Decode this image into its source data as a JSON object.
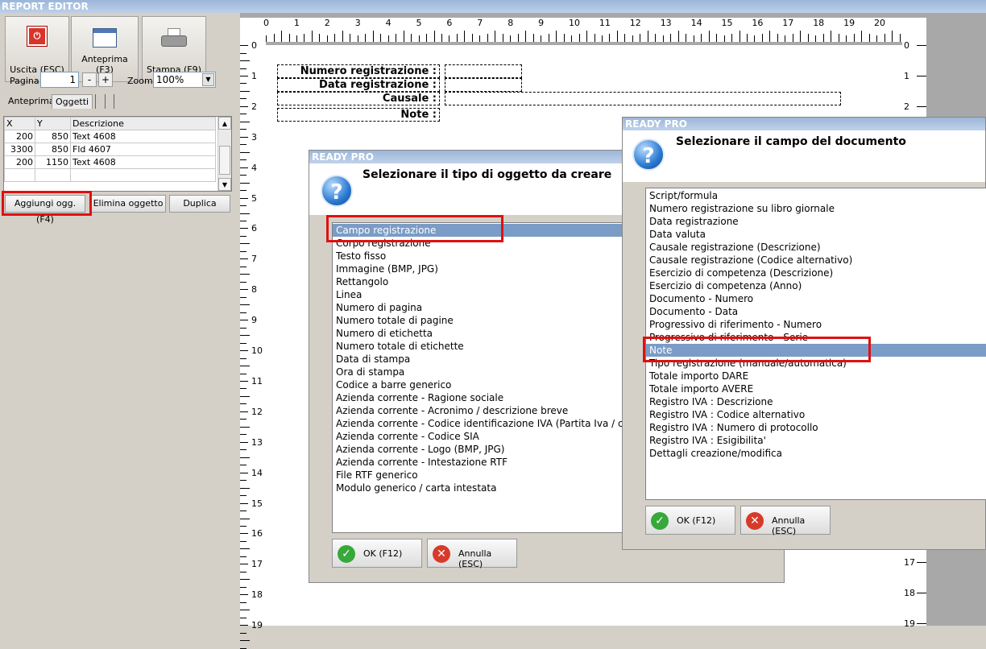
{
  "app": {
    "title": "REPORT EDITOR"
  },
  "toolbar": {
    "exit": "Uscita (ESC)",
    "preview": "Anteprima (F3)",
    "print": "Stampa (F9)"
  },
  "pager": {
    "page_label": "Pagina",
    "page_value": "1",
    "minus": "-",
    "plus": "+",
    "zoom_label": "Zoom",
    "zoom_value": "100%"
  },
  "tabs": {
    "preview": "Anteprima",
    "objects": "Oggetti"
  },
  "grid": {
    "headers": [
      "X",
      "Y",
      "Descrizione"
    ],
    "rows": [
      [
        "200",
        "850",
        "Text 4608"
      ],
      [
        "3300",
        "850",
        "Fld 4607"
      ],
      [
        "200",
        "1150",
        "Text 4608"
      ]
    ]
  },
  "objbuttons": {
    "add": "Aggiungi ogg.(F4)",
    "delete": "Elimina oggetto",
    "duplicate": "Duplica"
  },
  "ruler": {
    "top": [
      "0",
      "1",
      "2",
      "3",
      "4",
      "5",
      "6",
      "7",
      "8",
      "9",
      "10",
      "11",
      "12",
      "13",
      "14",
      "15",
      "16",
      "17",
      "18",
      "19",
      "20"
    ],
    "left": [
      "0",
      "1",
      "2",
      "3",
      "4",
      "5",
      "6",
      "7",
      "8",
      "9",
      "10",
      "11",
      "12",
      "13",
      "14",
      "15",
      "16",
      "17",
      "18",
      "19"
    ],
    "right": [
      "0",
      "1",
      "2",
      "17",
      "18",
      "19"
    ]
  },
  "report": {
    "fields": [
      "Numero registrazione :",
      "Data registrazione :",
      "Causale :",
      "Note :"
    ]
  },
  "dialog1": {
    "titlebar": "READY PRO",
    "heading": "Selezionare il tipo di oggetto da creare",
    "items": [
      "Campo registrazione",
      "Corpo registrazione",
      "Testo fisso",
      "Immagine (BMP, JPG)",
      "Rettangolo",
      "Linea",
      "Numero di pagina",
      "Numero totale di pagine",
      "Numero di etichetta",
      "Numero totale di etichette",
      "Data di stampa",
      "Ora di stampa",
      "Codice a barre generico",
      "Azienda corrente - Ragione sociale",
      "Azienda corrente - Acronimo / descrizione breve",
      "Azienda corrente - Codice identificazione IVA (Partita Iva / cod",
      "Azienda corrente - Codice SIA",
      "Azienda corrente - Logo (BMP, JPG)",
      "Azienda corrente - Intestazione RTF",
      "File RTF generico",
      "Modulo generico / carta intestata"
    ],
    "ok": "OK (F12)",
    "cancel": "Annulla (ESC)"
  },
  "dialog2": {
    "titlebar": "READY PRO",
    "heading": "Selezionare il campo del documento",
    "items": [
      "Script/formula",
      "Numero registrazione su libro giornale",
      "Data registrazione",
      "Data valuta",
      "Causale registrazione (Descrizione)",
      "Causale registrazione (Codice alternativo)",
      "Esercizio di competenza (Descrizione)",
      "Esercizio di competenza (Anno)",
      "Documento - Numero",
      "Documento - Data",
      "Progressivo di riferimento - Numero",
      "Progressivo di riferimento - Serie",
      "Note",
      "Tipo registrazione (manuale/automatica)",
      "Totale importo DARE",
      "Totale importo AVERE",
      "Registro IVA : Descrizione",
      "Registro IVA : Codice alternativo",
      "Registro IVA : Numero di protocollo",
      "Registro IVA : Esigibilita'",
      "Dettagli creazione/modifica"
    ],
    "ok": "OK (F12)",
    "cancel": "Annulla (ESC)"
  }
}
